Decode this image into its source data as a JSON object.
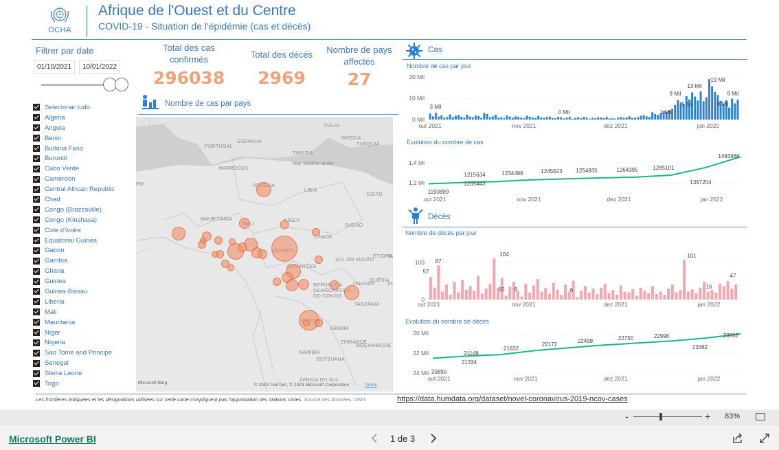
{
  "header": {
    "logo_text": "OCHA",
    "title": "Afrique de l'Ouest et du Centre",
    "subtitle": "COVID-19 - Situation de l'épidémie (cas et décès)"
  },
  "filter": {
    "title": "Filtrer par date",
    "date_start": "01/10/2021",
    "date_end": "10/01/2022"
  },
  "countries": [
    "Selecionar tudo",
    "Algeria",
    "Angola",
    "Benin",
    "Burkina Faso",
    "Burundi",
    "Cabo Verde",
    "Cameroon",
    "Central African Republic",
    "Chad",
    "Congo (Brazzaville)",
    "Congo (Kinshasa)",
    "Cote d'Ivoire",
    "Equatorial Guinea",
    "Gabon",
    "Gambia",
    "Ghana",
    "Guinea",
    "Guinea-Bissau",
    "Liberia",
    "Mali",
    "Mauritania",
    "Niger",
    "Nigeria",
    "Sao Tome and Principe",
    "Senegal",
    "Sierra Leone",
    "Togo"
  ],
  "kpis": {
    "cases_label": "Total des cas confirmés",
    "cases_value": "296038",
    "deaths_label": "Total des décès",
    "deaths_value": "2969",
    "countries_label": "Nombre de pays affectés",
    "countries_value": "27"
  },
  "map": {
    "title": "Nombre de cas par pays",
    "attribution": "© 2023 TomTom, © 2023 Microsoft Corporation",
    "terms": "Terms",
    "bing": "Microsoft Bing",
    "labels": [
      "ESPANHA",
      "PORTUGAL",
      "ITÁLIA",
      "TURQUIA",
      "GRÉCIA",
      "MARROCOS",
      "TUNÍSIA",
      "Mar Mediterrâneo",
      "ARGÉLIA",
      "LÍBIA",
      "EGITO",
      "MAURITÂNIA",
      "MALI",
      "NÍGER",
      "CHADE",
      "SUDÃO",
      "NIGÉRIA",
      "SUL DO SUDÃO",
      "ETIÓPIA",
      "CAMARÕES",
      "REPÚBLICA DEMOCRÁTICA DO CONGO",
      "TANZÂNIA",
      "ANGOLA",
      "ZÂMBIA",
      "NAMÍBIA",
      "BOTSUANA",
      "ÁFRICA DO SUL",
      "MOÇAMBIQUE",
      "ZIMBÁBUE",
      "QUÊNIA",
      "UGANDA",
      "SO",
      "RI",
      "EM"
    ]
  },
  "cases_section": {
    "title": "Cas",
    "daily_title": "Nombre de cas par jour",
    "evolution_title": "Evolution du nombre de cas"
  },
  "deaths_section": {
    "title": "Décès",
    "daily_title": "Nombre de décès par jour",
    "evolution_title": "Evolution du nombre de décès"
  },
  "chart_data": [
    {
      "type": "bar",
      "title": "Nombre de cas par jour",
      "x_ticks": [
        "out 2021",
        "nov 2021",
        "dez 2021",
        "jan 2022"
      ],
      "y_ticks": [
        "0 Mil",
        "10 Mil",
        "20 Mil"
      ],
      "ylim": [
        0,
        20000
      ],
      "color": "#2a7fd6",
      "data_labels": [
        "3 Mil",
        "0 Mil",
        "1 Mil",
        "9 Mil",
        "13 Mil",
        "19 Mil",
        "5 Mil",
        "9 Mil",
        "9 Mil"
      ],
      "values": [
        2800,
        1500,
        3200,
        1400,
        2000,
        900,
        1200,
        2400,
        1100,
        1800,
        2100,
        1300,
        900,
        2300,
        1400,
        1000,
        1900,
        1700,
        800,
        3100,
        2600,
        1100,
        1500,
        2200,
        900,
        1100,
        700,
        1900,
        1400,
        800,
        1500,
        1200,
        1000,
        600,
        1800,
        1300,
        900,
        700,
        1700,
        1000,
        800,
        1200,
        1400,
        700,
        600,
        1300,
        1100,
        500,
        900,
        1200,
        400,
        700,
        1000,
        600,
        1300,
        900,
        400,
        800,
        600,
        1100,
        900,
        700,
        1300,
        500,
        600,
        400,
        900,
        1200,
        800,
        1000,
        1500,
        700,
        900,
        1100,
        1800,
        2100,
        1500,
        1200,
        3400,
        2600,
        2200,
        3000,
        4000,
        3500,
        4300,
        5000,
        6800,
        9200,
        8000,
        7300,
        11000,
        9500,
        12700,
        10800,
        9000,
        13200,
        8600,
        10500,
        19000,
        15600,
        13000,
        11500,
        8800,
        7200,
        9100,
        5600,
        9800,
        7600,
        9400
      ]
    },
    {
      "type": "line",
      "title": "Evolution du nombre de cas",
      "x_ticks": [
        "out 2021",
        "nov 2021",
        "dez 2021",
        "jan 2022"
      ],
      "y_ticks": [
        "1,2 Mi",
        "1,4 Mi"
      ],
      "ylim": [
        1180000,
        1500000
      ],
      "color": "#17b395",
      "data_labels": [
        "1190899",
        "1215634",
        "1205443",
        "1234496",
        "1245623",
        "1254835",
        "1264395",
        "1285101",
        "1367204",
        "1483986"
      ],
      "values": [
        1190899,
        1205443,
        1215634,
        1234496,
        1245623,
        1254835,
        1264395,
        1285101,
        1367204,
        1483986
      ]
    },
    {
      "type": "bar",
      "title": "Nombre de décès par jour",
      "x_ticks": [
        "out 2021",
        "nov 2021",
        "dez 2021",
        "jan 2022"
      ],
      "y_ticks": [
        "0",
        "100"
      ],
      "ylim": [
        0,
        110
      ],
      "color": "#f6a7ad",
      "data_labels": [
        "57",
        "87",
        "104",
        "10",
        "8",
        "6",
        "101",
        "16",
        "47"
      ],
      "values": [
        57,
        30,
        87,
        20,
        38,
        12,
        45,
        18,
        50,
        25,
        35,
        22,
        60,
        15,
        28,
        40,
        104,
        30,
        55,
        10,
        33,
        45,
        22,
        8,
        40,
        18,
        36,
        52,
        20,
        30,
        15,
        42,
        25,
        12,
        38,
        20,
        48,
        6,
        22,
        35,
        18,
        28,
        14,
        30,
        40,
        16,
        24,
        12,
        36,
        20,
        18,
        26,
        10,
        30,
        22,
        16,
        34,
        14,
        20,
        12,
        28,
        38,
        18,
        24,
        101,
        20,
        26,
        16,
        30,
        45,
        20,
        24,
        18,
        40,
        34,
        47,
        28,
        38
      ]
    },
    {
      "type": "line",
      "title": "Evolution du nombre de décès",
      "x_ticks": [
        "out 2021",
        "nov 2021",
        "dez 2021",
        "jan 2022"
      ],
      "y_ticks": [
        "20 Mil",
        "22 Mil",
        "24 Mil"
      ],
      "ylim": [
        20000,
        24200
      ],
      "color": "#17b395",
      "data_labels": [
        "20890",
        "21148",
        "21334",
        "21832",
        "22172",
        "22498",
        "22750",
        "22998",
        "23362",
        "23862"
      ],
      "values": [
        20890,
        21148,
        21334,
        21832,
        22172,
        22498,
        22750,
        22998,
        23362,
        23862
      ]
    }
  ],
  "footer": {
    "note": "Les frontières indiquées et les désignations utilisées sur cette carte n'impliquent pas l'approbation des Nations Unies.",
    "source_prefix": "Source des données: OMS",
    "source_link": "https://data.humdata.org/dataset/novel-coronavirus-2019-ncov-cases"
  },
  "zoom": {
    "minus": "-",
    "plus": "+",
    "value": "83%"
  },
  "bottom": {
    "brand": "Microsoft Power BI",
    "page": "1 de 3"
  }
}
